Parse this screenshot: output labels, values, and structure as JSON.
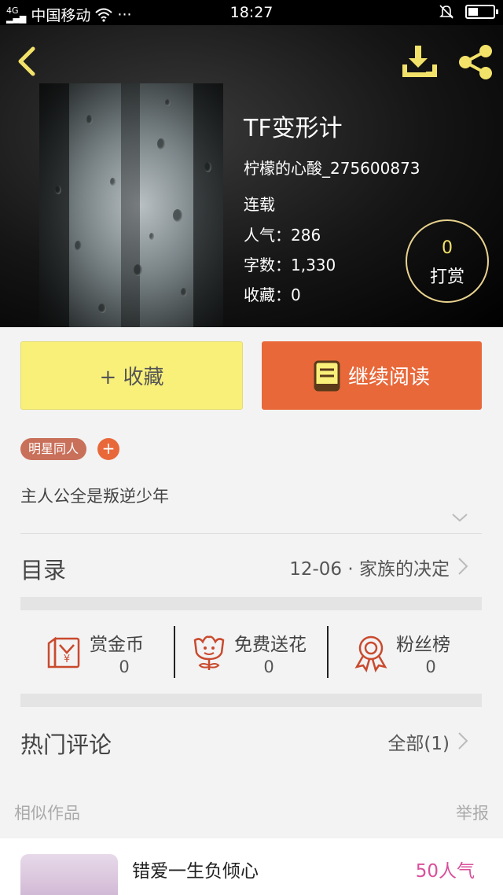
{
  "status_bar": {
    "carrier": "中国移动",
    "time": "18:27",
    "signal_label": "4G",
    "menu_dots": "···"
  },
  "header": {
    "back_icon": "chevron-left-icon",
    "download_icon": "download-icon",
    "share_icon": "share-icon"
  },
  "book": {
    "title": "TF变形计",
    "author": "柠檬的心酸_275600873",
    "status": "连载",
    "popularity": "人气：286",
    "word_count": "字数：1,330",
    "favorites": "收藏：0"
  },
  "tip": {
    "count": "0",
    "label": "打赏"
  },
  "actions": {
    "favorite_label": "+ 收藏",
    "read_label": "继续阅读"
  },
  "tags": [
    "明星同人"
  ],
  "tag_add": "+",
  "summary": "主人公全是叛逆少年",
  "catalog": {
    "title": "目录",
    "latest": "12-06 · 家族的决定"
  },
  "rewards": [
    {
      "name": "赏金币",
      "value": "0",
      "icon": "coin-envelope-icon"
    },
    {
      "name": "免费送花",
      "value": "0",
      "icon": "flower-icon"
    },
    {
      "name": "粉丝榜",
      "value": "0",
      "icon": "medal-icon"
    }
  ],
  "comments": {
    "title": "热门评论",
    "all_label": "全部(1)"
  },
  "similar": {
    "label": "相似作品",
    "report": "举报",
    "items": [
      {
        "title": "错爱一生负倾心",
        "popularity": "50人气"
      }
    ]
  },
  "colors": {
    "accent_orange": "#e8683a",
    "fav_yellow": "#f9f07a",
    "tag_brown": "#c9705a",
    "popularity_pink": "#d9509a",
    "icon_yellow": "#f3e26a"
  }
}
